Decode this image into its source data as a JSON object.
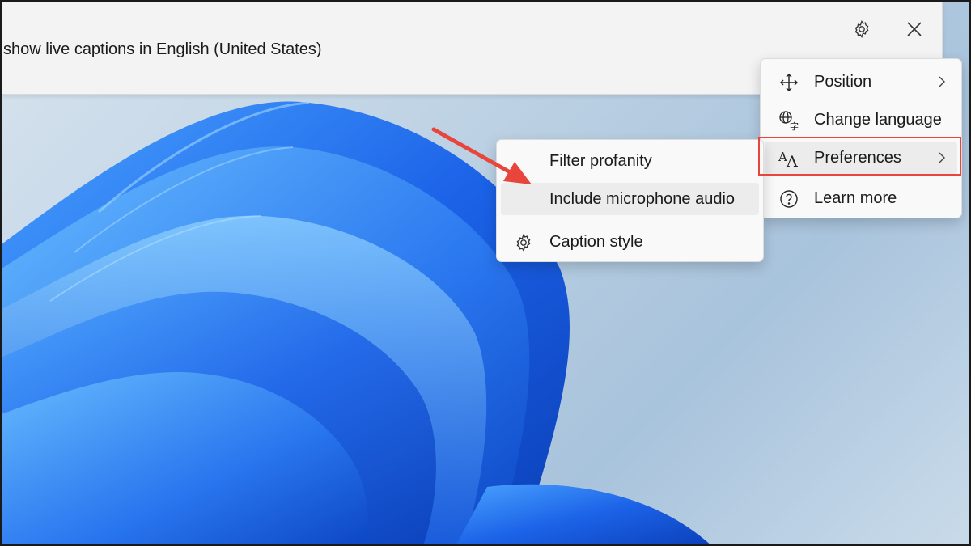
{
  "caption_bar": {
    "text": "show live captions in English (United States)",
    "settings_icon": "gear-icon",
    "close_icon": "close-icon"
  },
  "main_menu": {
    "items": [
      {
        "label": "Position",
        "icon": "move-arrows-icon",
        "has_submenu": true
      },
      {
        "label": "Change language",
        "icon": "language-icon",
        "has_submenu": false
      },
      {
        "label": "Preferences",
        "icon": "font-size-icon",
        "has_submenu": true
      },
      {
        "label": "Learn more",
        "icon": "help-icon",
        "has_submenu": false
      }
    ]
  },
  "preferences_submenu": {
    "items": [
      {
        "label": "Filter profanity",
        "icon": null
      },
      {
        "label": "Include microphone audio",
        "icon": null
      },
      {
        "label": "Caption style",
        "icon": "gear-icon"
      }
    ]
  },
  "annotation": {
    "highlight_color": "#e8453c",
    "arrow_color": "#e8453c"
  },
  "colors": {
    "wallpaper_blue": "#1f6fe6",
    "menu_bg": "#f9f9f9",
    "caption_bg": "#f3f3f3"
  }
}
